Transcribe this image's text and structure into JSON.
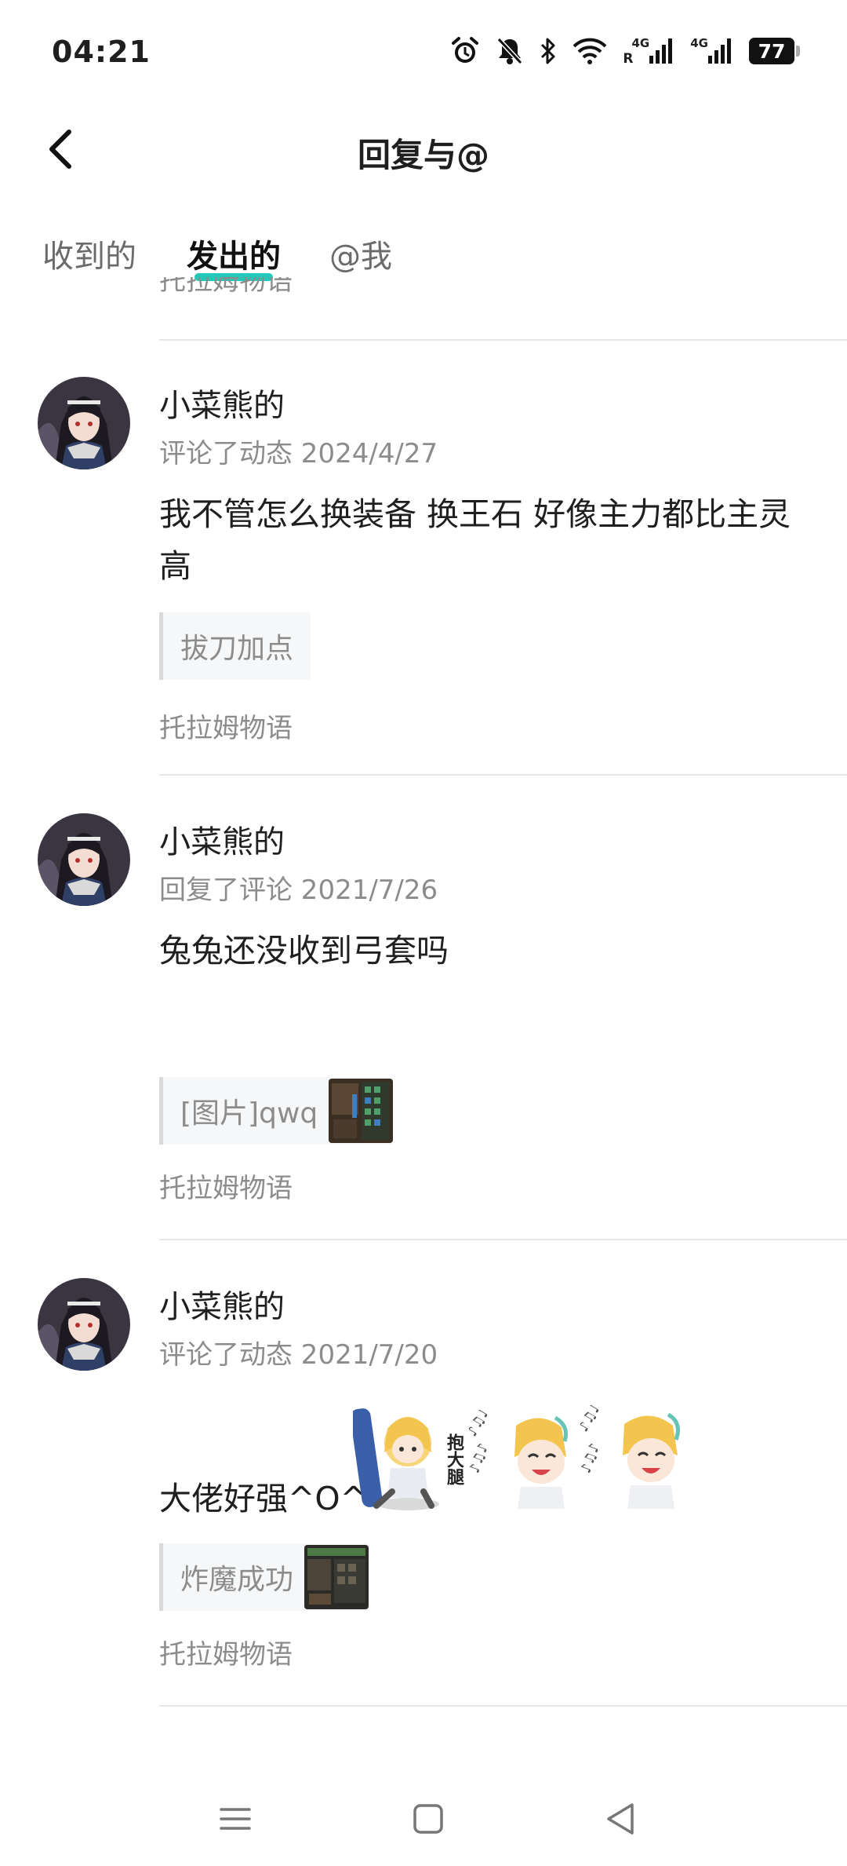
{
  "status_bar": {
    "time": "04:21",
    "network_1": "4G",
    "network_2": "4G",
    "roaming": "R",
    "battery": "77",
    "icons": [
      "alarm-icon",
      "bell-off-icon",
      "bluetooth-icon",
      "wifi-icon",
      "signal-icon",
      "signal-icon",
      "battery-icon"
    ]
  },
  "header": {
    "title": "回复与@",
    "back_icon": "chevron-left-icon"
  },
  "tabs": [
    {
      "label": "收到的",
      "active": false
    },
    {
      "label": "发出的",
      "active": true
    },
    {
      "label": "@我",
      "active": false
    }
  ],
  "accent_color": "#23c9b8",
  "clipped_top_source": "托拉姆物语",
  "items": [
    {
      "username": "小菜熊的",
      "meta": "评论了动态 2024/4/27",
      "content": "我不管怎么换装备 换王石 好像主力都比主灵高",
      "quote": "拔刀加点",
      "source": "托拉姆物语"
    },
    {
      "username": "小菜熊的",
      "meta": "回复了评论 2021/7/26",
      "content": "兔兔还没收到弓套吗",
      "quote": "[图片]qwq",
      "source": "托拉姆物语"
    },
    {
      "username": "小菜熊的",
      "meta": "评论了动态 2021/7/20",
      "content": "大佬好强^O^",
      "sticker_text": "抱大腿",
      "quote": "炸魔成功",
      "source": "托拉姆物语"
    }
  ],
  "nav_bar": {
    "icons": [
      "menu-icon",
      "home-square-icon",
      "back-triangle-icon"
    ]
  }
}
